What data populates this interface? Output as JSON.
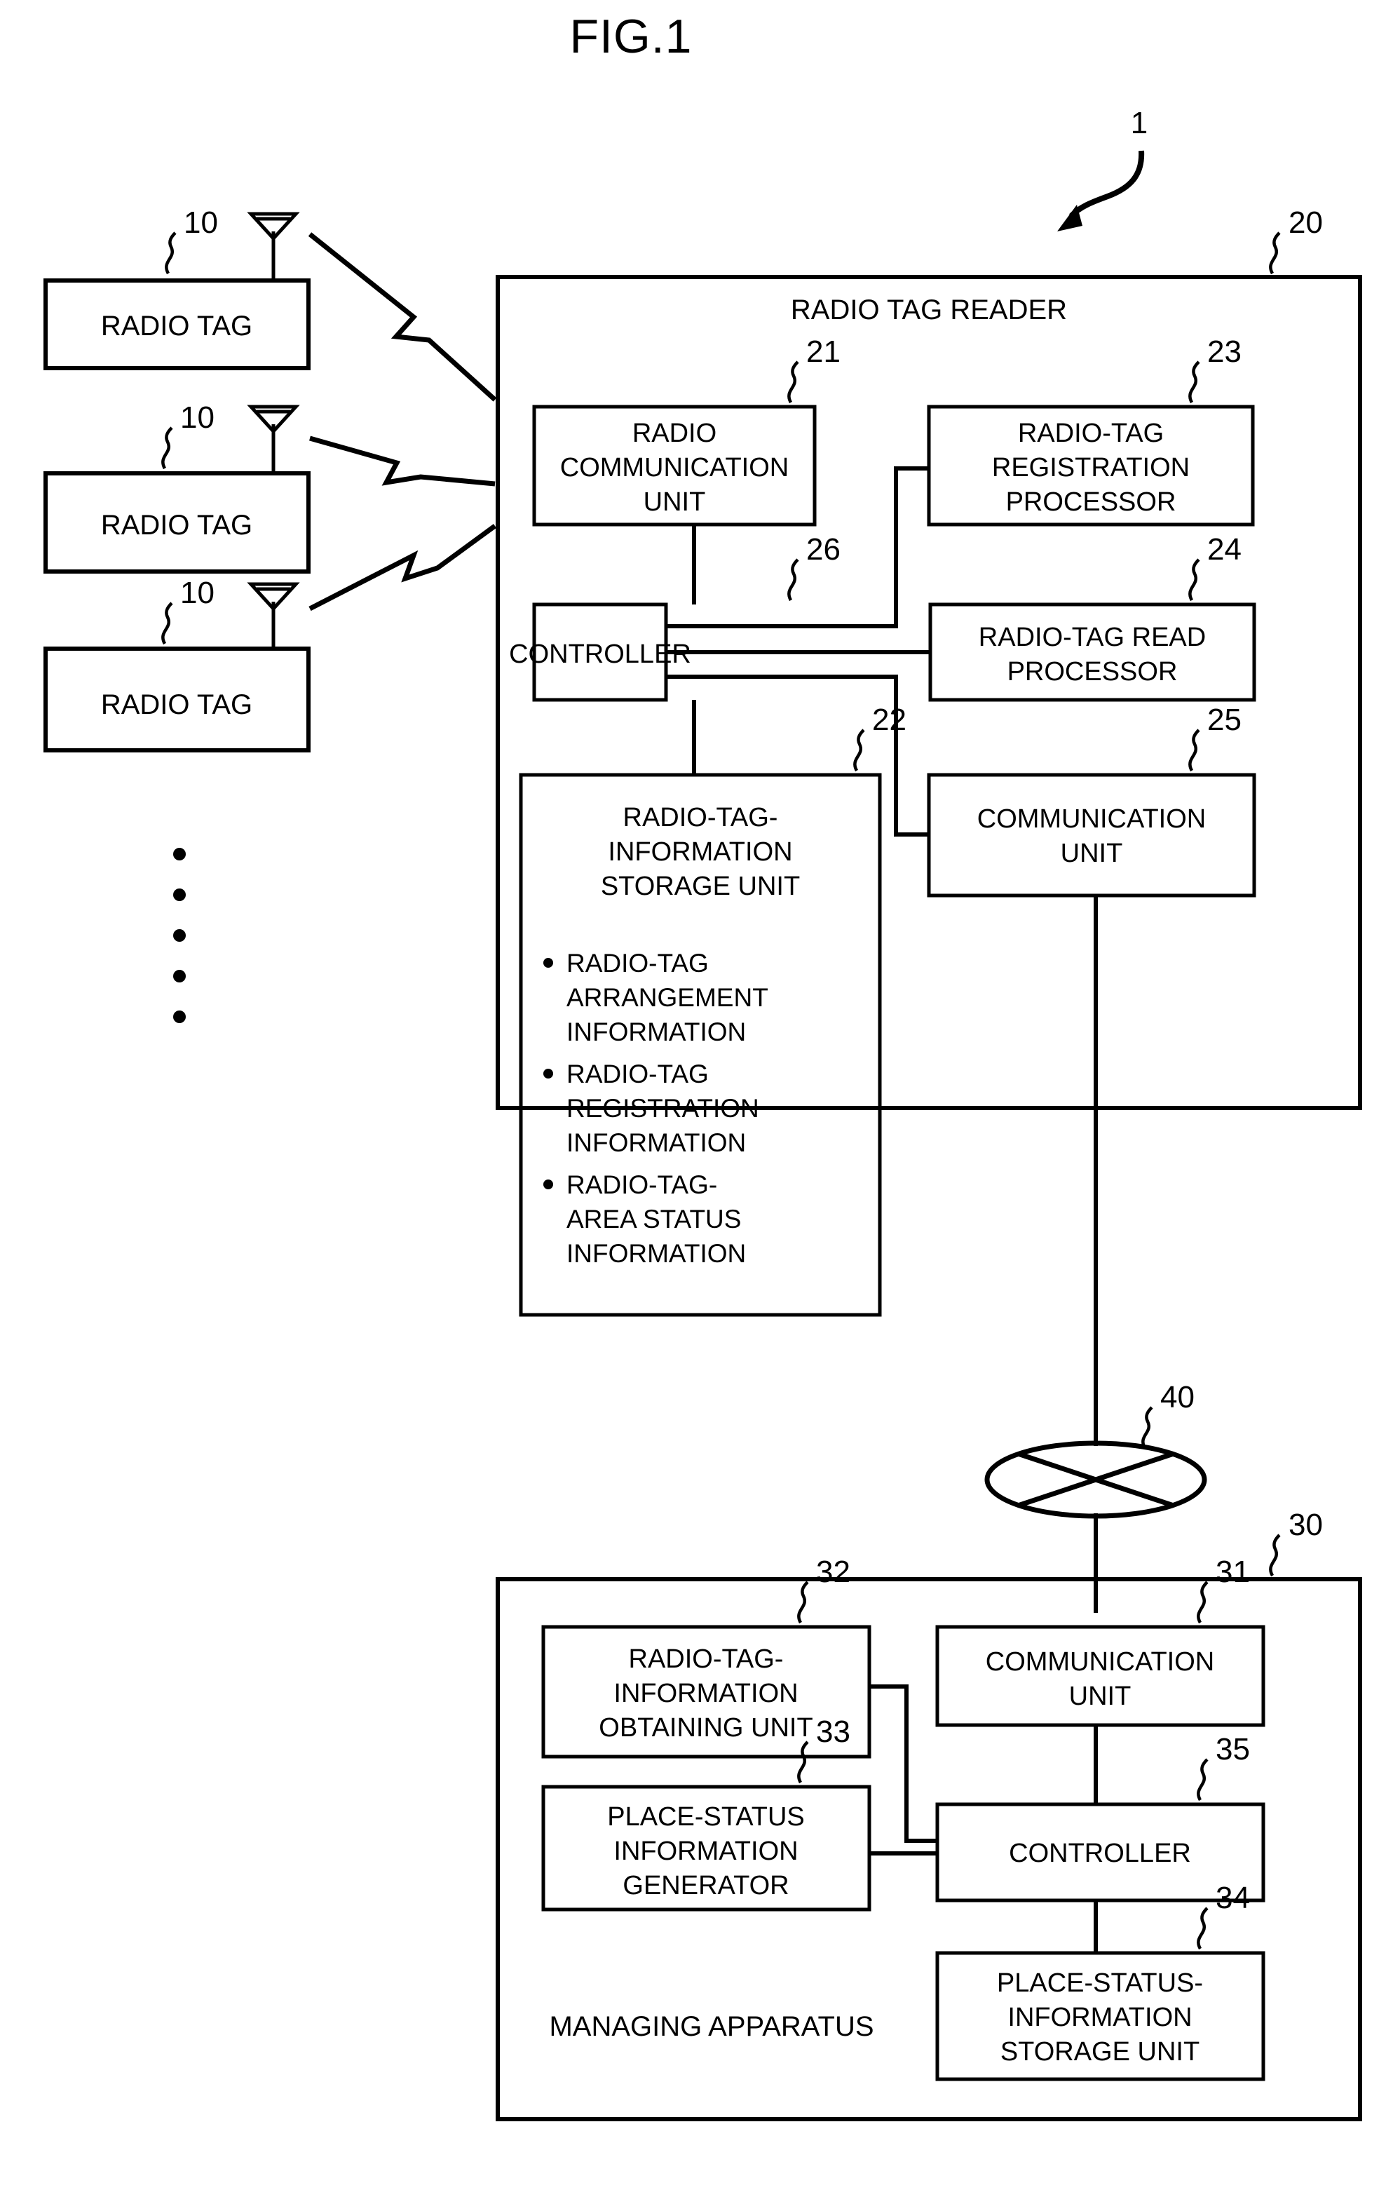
{
  "figure": {
    "title": "FIG.1",
    "system_ref": "1"
  },
  "tags": {
    "ref": "10",
    "label": "RADIO TAG",
    "count": 3,
    "ellipsis_dots": 5,
    "antenna_icon": "antenna-icon",
    "wave_icon": "radio-wave-icon"
  },
  "reader": {
    "ref": "20",
    "title": "RADIO TAG READER",
    "units": {
      "radio_comm": {
        "ref": "21",
        "lines": [
          "RADIO",
          "COMMUNICATION",
          "UNIT"
        ]
      },
      "registration": {
        "ref": "23",
        "lines": [
          "RADIO-TAG",
          "REGISTRATION",
          "PROCESSOR"
        ]
      },
      "controller": {
        "ref": "26",
        "lines": [
          "CONTROLLER"
        ]
      },
      "read_processor": {
        "ref": "24",
        "lines": [
          "RADIO-TAG READ",
          "PROCESSOR"
        ]
      },
      "storage": {
        "ref": "22",
        "lines": [
          "RADIO-TAG-",
          "INFORMATION",
          "STORAGE UNIT"
        ],
        "bullets": [
          [
            "RADIO-TAG",
            "ARRANGEMENT",
            "INFORMATION"
          ],
          [
            "RADIO-TAG",
            "REGISTRATION",
            "INFORMATION"
          ],
          [
            "RADIO-TAG-",
            "AREA  STATUS",
            "INFORMATION"
          ]
        ]
      },
      "comm": {
        "ref": "25",
        "lines": [
          "COMMUNICATION",
          "UNIT"
        ]
      }
    }
  },
  "network": {
    "ref": "40",
    "icon": "network-cloud-icon"
  },
  "manager": {
    "ref": "30",
    "title": "MANAGING APPARATUS",
    "units": {
      "obtaining": {
        "ref": "32",
        "lines": [
          "RADIO-TAG-",
          "INFORMATION",
          "OBTAINING UNIT"
        ]
      },
      "comm": {
        "ref": "31",
        "lines": [
          "COMMUNICATION",
          "UNIT"
        ]
      },
      "generator": {
        "ref": "33",
        "lines": [
          "PLACE-STATUS",
          "INFORMATION",
          "GENERATOR"
        ]
      },
      "controller": {
        "ref": "35",
        "lines": [
          "CONTROLLER"
        ]
      },
      "storage": {
        "ref": "34",
        "lines": [
          "PLACE-STATUS-",
          "INFORMATION",
          "STORAGE UNIT"
        ]
      }
    }
  },
  "colors": {
    "ink": "#000000",
    "paper": "#ffffff"
  }
}
